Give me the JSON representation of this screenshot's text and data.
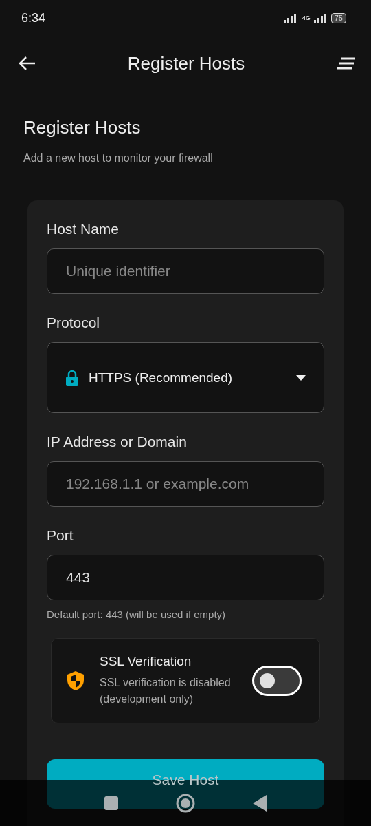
{
  "status_bar": {
    "time": "6:34",
    "network": "4G",
    "battery": "75"
  },
  "app_bar": {
    "title": "Register Hosts"
  },
  "header": {
    "title": "Register Hosts",
    "subtitle": "Add a new host to monitor your firewall"
  },
  "form": {
    "fields": [
      {
        "kind": "text",
        "label": "Host Name",
        "placeholder": "Unique identifier"
      },
      {
        "kind": "select",
        "label": "Protocol",
        "value": "HTTPS (Recommended)"
      },
      {
        "kind": "text",
        "label": "IP Address or Domain",
        "placeholder": "192.168.1.1 or example.com"
      },
      {
        "kind": "text",
        "label": "Port",
        "value": "443",
        "helper": "Default port: 443 (will be used if empty)"
      }
    ],
    "ssl": {
      "title": "SSL Verification",
      "description": "SSL verification is disabled (development only)",
      "on": false
    },
    "submit": "Save Host"
  }
}
